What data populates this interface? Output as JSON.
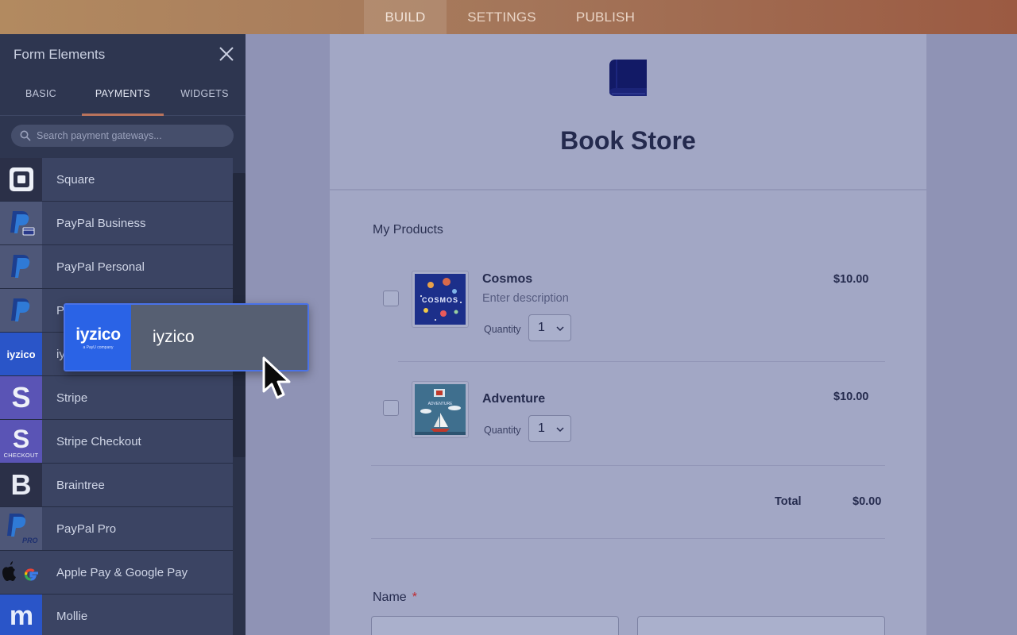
{
  "topbar": {
    "tabs": [
      {
        "label": "BUILD",
        "active": true
      },
      {
        "label": "SETTINGS",
        "active": false
      },
      {
        "label": "PUBLISH",
        "active": false
      }
    ]
  },
  "sidebar": {
    "title": "Form Elements",
    "tabs": [
      {
        "label": "BASIC",
        "active": false
      },
      {
        "label": "PAYMENTS",
        "active": true
      },
      {
        "label": "WIDGETS",
        "active": false
      }
    ],
    "search_placeholder": "Search payment gateways...",
    "gateways": [
      {
        "label": "Square",
        "icon": "square-icon",
        "icon_bg": "#2b3048"
      },
      {
        "label": "PayPal Business",
        "icon": "paypal-business-icon",
        "icon_bg": "#4e5778"
      },
      {
        "label": "PayPal Personal",
        "icon": "paypal-icon",
        "icon_bg": "#4e5778"
      },
      {
        "label": "P",
        "icon": "paypal-icon",
        "icon_bg": "#4e5778"
      },
      {
        "label": "iy",
        "icon": "iyzico-icon",
        "icon_bg": "#2a55c8",
        "icon_text": "iyzico"
      },
      {
        "label": "Stripe",
        "icon": "stripe-icon",
        "icon_bg": "#5a54b5"
      },
      {
        "label": "Stripe Checkout",
        "icon": "stripe-checkout-icon",
        "icon_bg": "#5a54b5",
        "icon_caption": "CHECKOUT"
      },
      {
        "label": "Braintree",
        "icon": "braintree-icon",
        "icon_bg": "#2b3048"
      },
      {
        "label": "PayPal Pro",
        "icon": "paypal-pro-icon",
        "icon_bg": "#4e5778",
        "icon_caption": "PRO"
      },
      {
        "label": "Apple Pay & Google Pay",
        "icon": "apple-google-pay-icon",
        "icon_bg": "#3b4463"
      },
      {
        "label": "Mollie",
        "icon": "mollie-icon",
        "icon_bg": "#2a55c8"
      }
    ]
  },
  "form": {
    "title": "Book Store",
    "section_title": "My Products",
    "products": [
      {
        "name": "Cosmos",
        "description": "Enter description",
        "price": "$10.00",
        "quantity_label": "Quantity",
        "quantity": "1",
        "thumb_text": "COSMOS"
      },
      {
        "name": "Adventure",
        "description": "",
        "price": "$10.00",
        "quantity_label": "Quantity",
        "quantity": "1",
        "thumb_text": "ADVENTURE"
      }
    ],
    "total_label": "Total",
    "total_value": "$0.00",
    "name_label": "Name",
    "required_mark": "*"
  },
  "drag_item": {
    "label": "iyzico",
    "logo_text": "iyzico",
    "logo_sub": "a PayU company"
  },
  "colors": {
    "accent_tab": "#b9735c",
    "drag_border": "#4a72e8",
    "required": "#c0282f"
  }
}
